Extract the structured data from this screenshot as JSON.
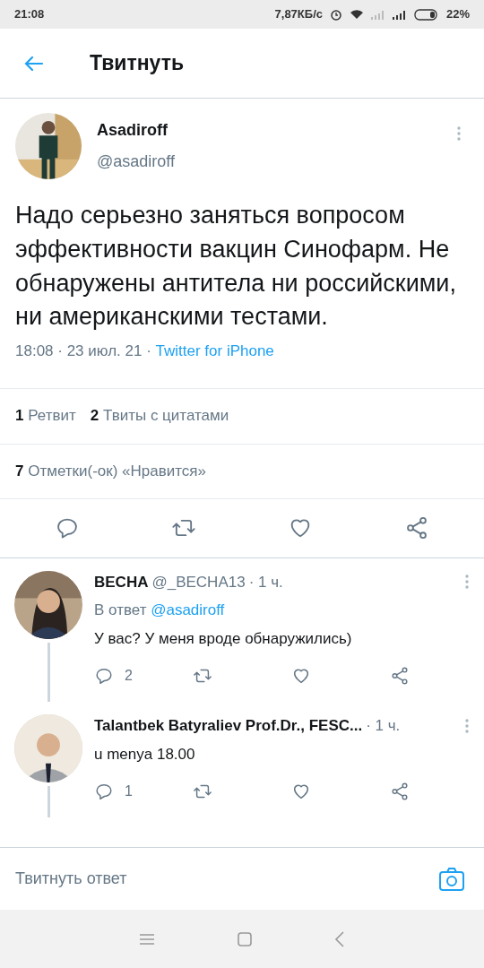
{
  "status_bar": {
    "time": "21:08",
    "speed": "7,87КБ/с",
    "battery": "22%"
  },
  "header": {
    "title": "Твитнуть"
  },
  "tweet": {
    "name": "Asadiroff",
    "handle": "@asadiroff",
    "text": "Надо серьезно заняться вопросом эффективности вакцин Синофарм. Не обнаружены антитела ни российскими, ни американскими тестами.",
    "meta": "18:08 · 23 июл. 21 · ",
    "source": "Twitter for iPhone"
  },
  "stats": [
    [
      {
        "count": "1",
        "label": "Ретвит"
      },
      {
        "count": "2",
        "label": "Твиты с цитатами"
      }
    ],
    [
      {
        "count": "7",
        "label": "Отметки(-ок) «Нравится»"
      }
    ]
  ],
  "replies": [
    {
      "name": "ВЕСНА",
      "handle": "@_ВЕСНА13",
      "time": "· 1 ч.",
      "reply_prefix": "В ответ",
      "reply_to": "@asadiroff",
      "text": "У вас? У меня вроде обнаружились)",
      "reply_count": "2"
    },
    {
      "name": "Talantbek Batyraliev Prof.Dr., FESC...",
      "time": "· 1 ч.",
      "text": "u menya 18.00",
      "reply_count": "1"
    }
  ],
  "compose": {
    "placeholder": "Твитнуть ответ"
  }
}
